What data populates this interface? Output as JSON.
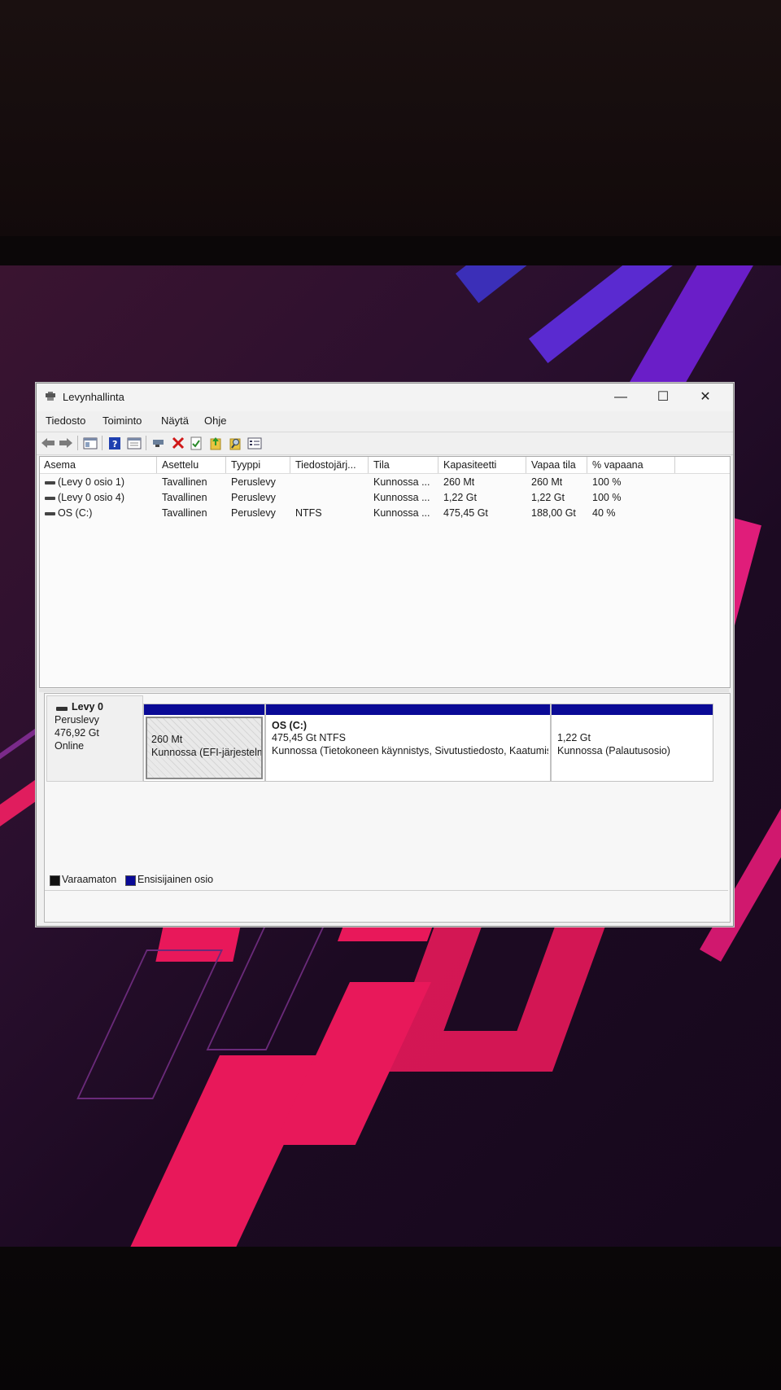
{
  "window": {
    "title": "Levynhallinta",
    "controls": [
      "—",
      "☐",
      "✕"
    ]
  },
  "menu": [
    "Tiedosto",
    "Toiminto",
    "Näytä",
    "Ohje"
  ],
  "toolbar": [
    "back-arrow-icon",
    "forward-arrow-icon",
    "console-tree-icon",
    "help-icon",
    "properties-icon",
    "connect-icon",
    "delete-icon",
    "check-icon",
    "import-icon",
    "search-icon",
    "list-view-icon"
  ],
  "volume_list": {
    "columns": [
      "Asema",
      "Asettelu",
      "Tyyppi",
      "Tiedostojärj...",
      "Tila",
      "Kapasiteetti",
      "Vapaa tila",
      "% vapaana"
    ],
    "rows": [
      [
        "(Levy 0 osio 1)",
        "Tavallinen",
        "Peruslevy",
        "",
        "Kunnossa ...",
        "260 Mt",
        "260 Mt",
        "100 %"
      ],
      [
        "(Levy 0 osio 4)",
        "Tavallinen",
        "Peruslevy",
        "",
        "Kunnossa ...",
        "1,22 Gt",
        "1,22 Gt",
        "100 %"
      ],
      [
        "OS (C:)",
        "Tavallinen",
        "Peruslevy",
        "NTFS",
        "Kunnossa ...",
        "475,45 Gt",
        "188,00 Gt",
        "40 %"
      ]
    ]
  },
  "disk": {
    "name": "Levy 0",
    "type": "Peruslevy",
    "size": "476,92 Gt",
    "status": "Online",
    "partitions": [
      {
        "size": "260 Mt",
        "status": "Kunnossa (EFI-järjestelmäosio)"
      },
      {
        "name": "OS  (C:)",
        "size": "475,45 Gt NTFS",
        "status": "Kunnossa (Tietokoneen käynnistys, Sivutustiedosto, Kaatumisvedos, Perusosio)"
      },
      {
        "size": "1,22 Gt",
        "status": "Kunnossa (Palautusosio)"
      }
    ]
  },
  "legend": [
    {
      "label": "Varaamaton",
      "color": "#111111"
    },
    {
      "label": "Ensisijainen osio",
      "color": "#0a0a96"
    }
  ],
  "colors": {
    "partition_bar": "#0a0a96",
    "wallpaper_accent": "#e8185a"
  }
}
